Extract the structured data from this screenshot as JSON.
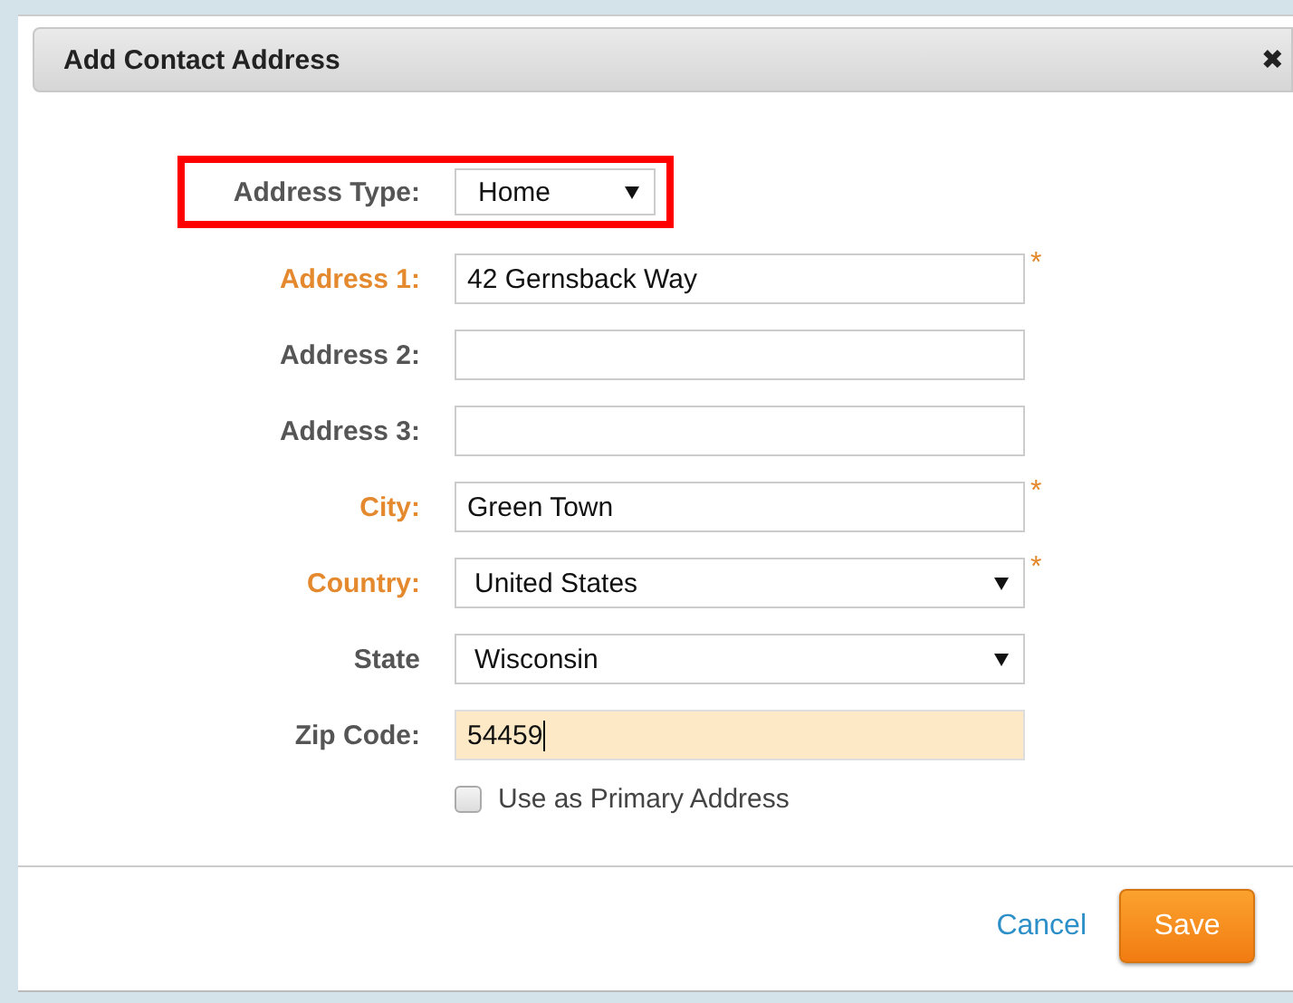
{
  "dialog": {
    "title": "Add Contact Address",
    "close": "✖"
  },
  "fields": [
    {
      "label": "Address Type:",
      "kind": "compact-select",
      "value": "Home",
      "required": false,
      "focused": false,
      "highlighted": true
    },
    {
      "label": "Address 1:",
      "kind": "text",
      "value": "42 Gernsback Way",
      "required": true,
      "focused": false,
      "highlighted": false
    },
    {
      "label": "Address 2:",
      "kind": "text",
      "required": false,
      "focused": false,
      "highlighted": false
    },
    {
      "label": "Address 3:",
      "kind": "text",
      "required": false,
      "focused": false,
      "highlighted": false
    },
    {
      "label": "City:",
      "kind": "text",
      "value": "Green Town",
      "required": true,
      "focused": false,
      "highlighted": false
    },
    {
      "label": "Country:",
      "kind": "select",
      "value": "United States",
      "required": true,
      "focused": false,
      "highlighted": false
    },
    {
      "label": "State",
      "kind": "select",
      "value": "Wisconsin",
      "required": false,
      "focused": false,
      "highlighted": false
    },
    {
      "label": "Zip Code:",
      "kind": "text",
      "value": "54459",
      "required": false,
      "focused": true,
      "highlighted": false
    }
  ],
  "required_mark": "*",
  "primary_checkbox": {
    "label": "Use as Primary Address",
    "checked": false
  },
  "buttons": {
    "cancel": "Cancel",
    "save": "Save"
  }
}
